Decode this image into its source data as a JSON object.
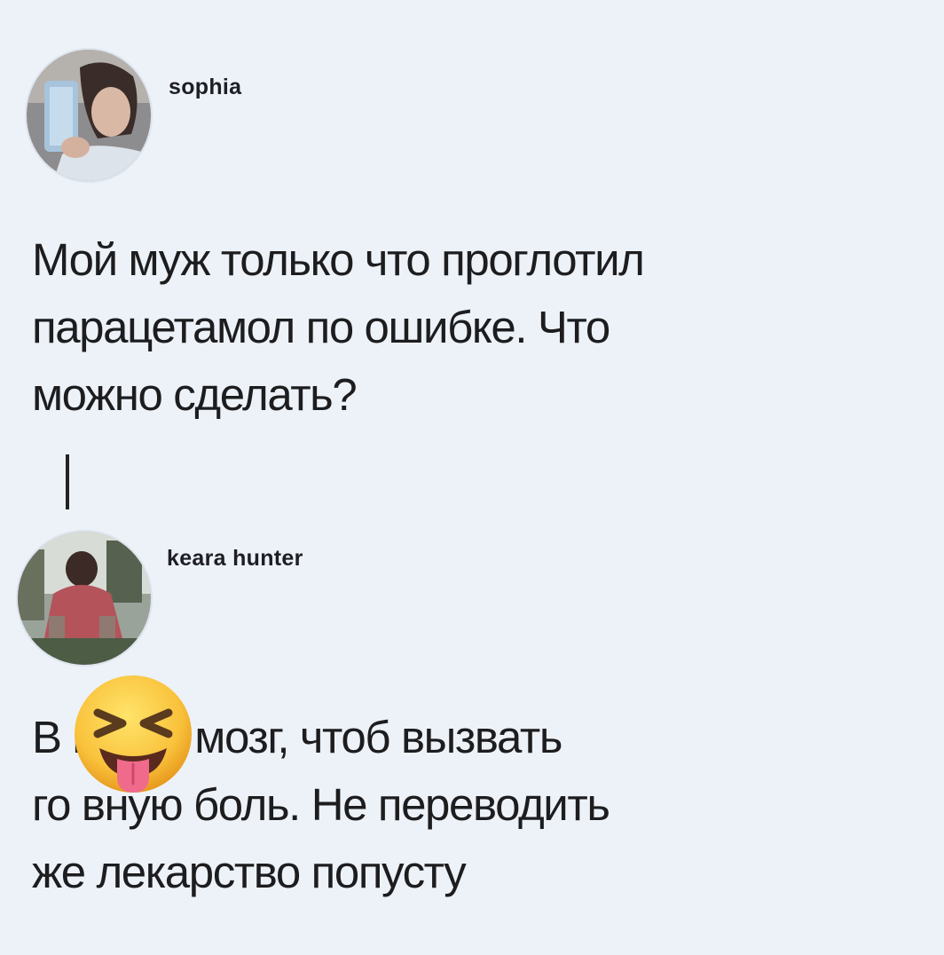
{
  "post": {
    "author": "sophia",
    "avatar_icon": "profile-photo",
    "lines": [
      "Мой муж только что проглотил",
      "парацетамол по ошибке. Что",
      "можно сделать?"
    ]
  },
  "reply": {
    "author": "keara hunter",
    "avatar_icon": "profile-photo",
    "lines": [
      "В     и ему мозг, чтоб вызвать",
      "го     вную боль. Не переводить",
      "же лекарство попусту"
    ]
  },
  "overlay": {
    "emoji_icon": "squinting-face-with-tongue-emoji"
  },
  "colors": {
    "background": "#edf2f8",
    "text": "#1d1d1f",
    "thread_line": "#222222"
  }
}
